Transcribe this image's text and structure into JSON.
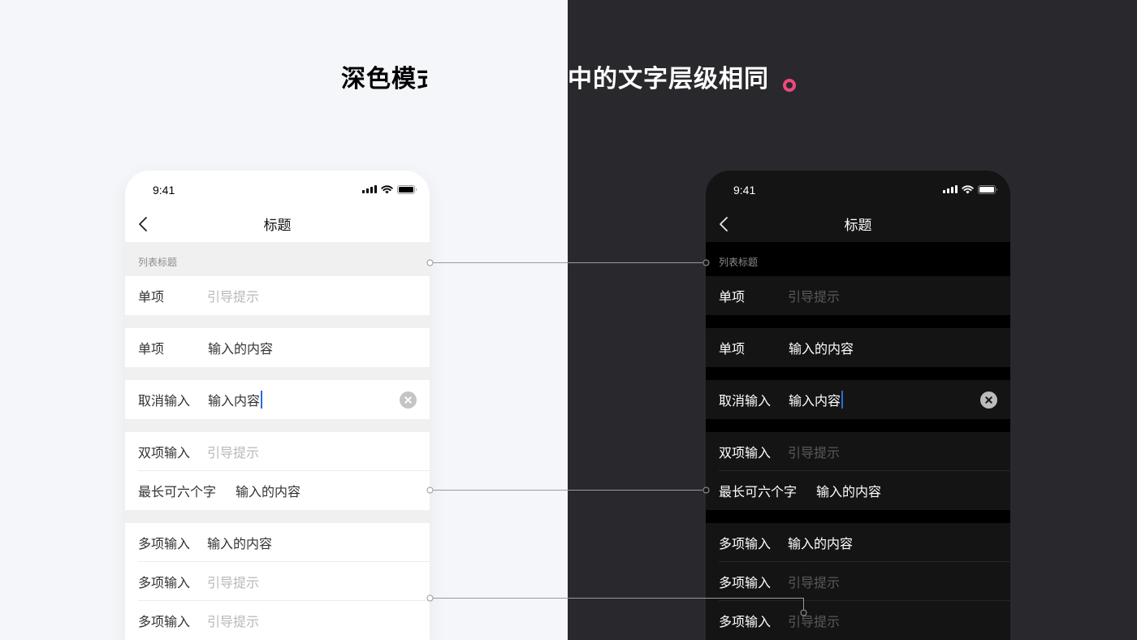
{
  "headline": {
    "text": "深色模式与浅色模式中的文字层级相同",
    "accent_color": "#f0487d"
  },
  "phone": {
    "time": "9:41",
    "title": "标题",
    "section_title": "列表标题",
    "rows": {
      "r1": {
        "label": "单项",
        "value": "引导提示"
      },
      "r2": {
        "label": "单项",
        "value": "输入的内容"
      },
      "r3": {
        "label": "取消输入",
        "value": "输入内容"
      },
      "r4": {
        "label": "双项输入",
        "value": "引导提示"
      },
      "r5": {
        "label": "最长可六个字",
        "value": "输入的内容"
      },
      "r6": {
        "label": "多项输入",
        "value": "输入的内容"
      },
      "r7": {
        "label": "多项输入",
        "value": "引导提示"
      },
      "r8": {
        "label": "多项输入",
        "value": "引导提示"
      }
    }
  },
  "theme": {
    "light_bg": "#f5f6fa",
    "dark_bg": "#29282d",
    "caret_color": "#2c6bd9"
  }
}
